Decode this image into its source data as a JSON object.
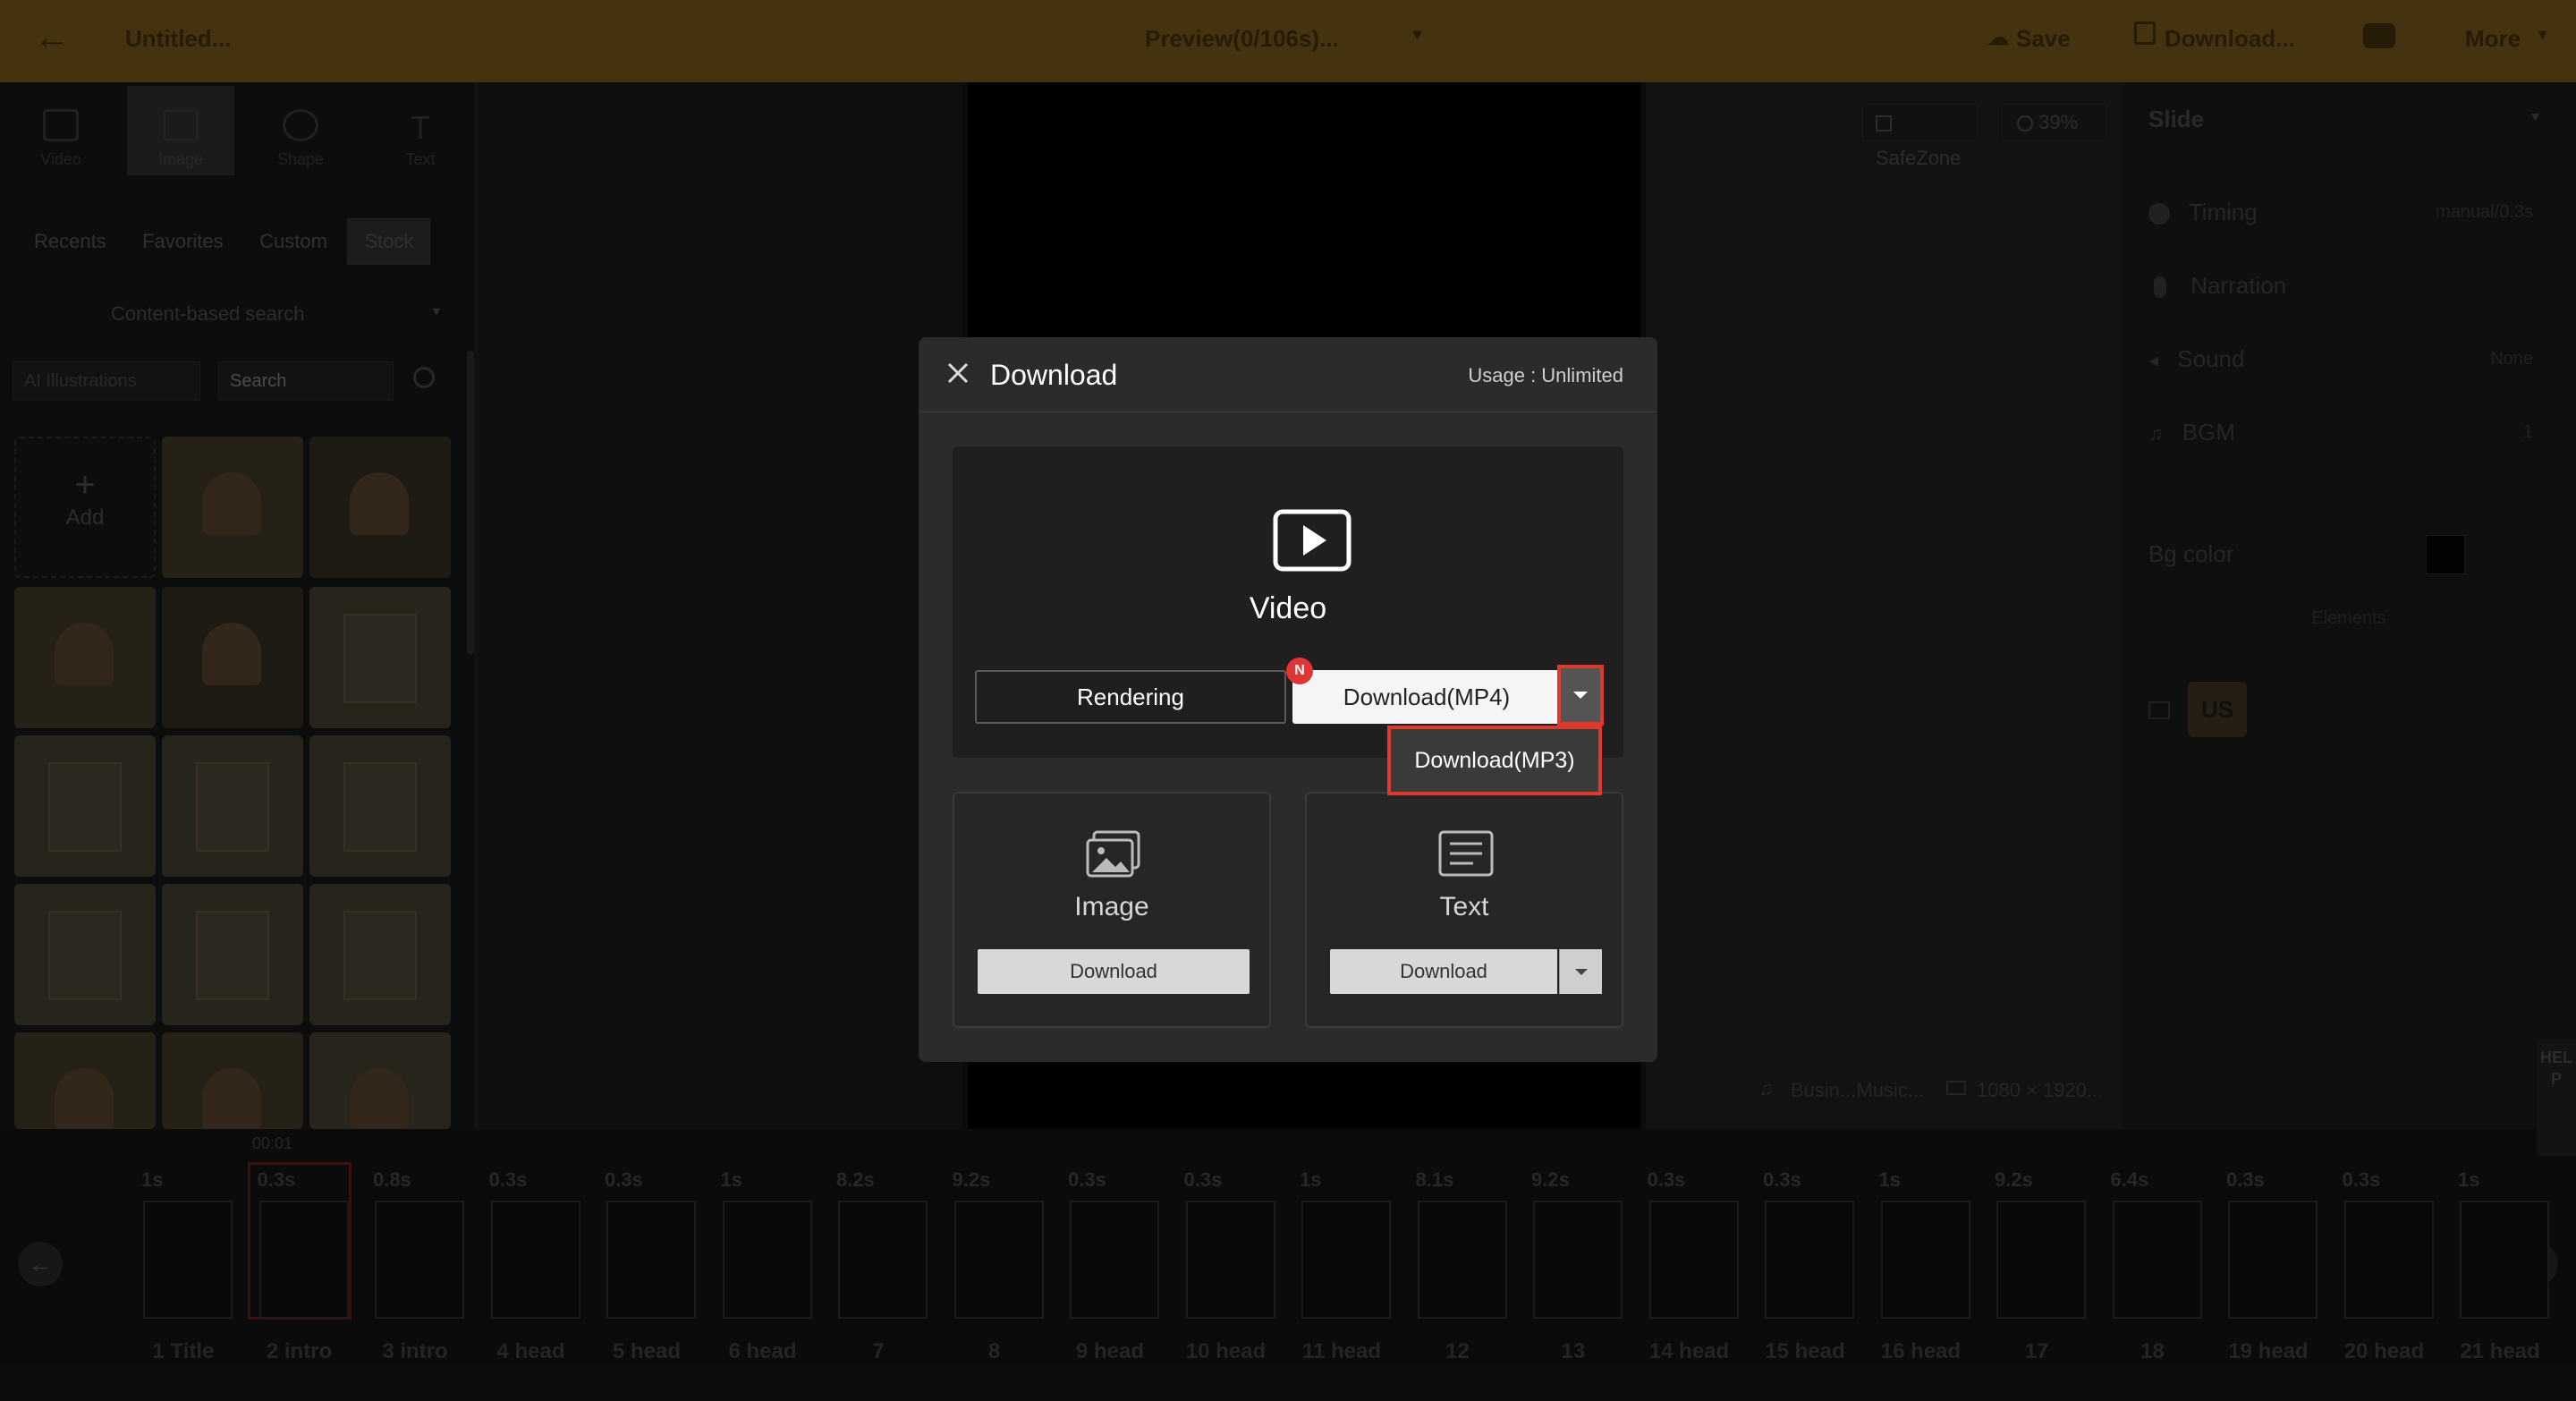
{
  "topbar": {
    "title": "Untitled...",
    "preview": "Preview(0/106s)...",
    "save": "Save",
    "download": "Download...",
    "more": "More"
  },
  "left_tools": [
    "Video",
    "Image",
    "Shape",
    "Text"
  ],
  "left_tabs": [
    "Recents",
    "Favorites",
    "Custom",
    "Stock"
  ],
  "search_mode": "Content-based search",
  "filter_select": "AI Illustrations",
  "search_placeholder": "Search",
  "add_label": "Add",
  "canvas_controls": {
    "safezone": "SafeZone",
    "zoom": "39%"
  },
  "right_panel": {
    "title": "Slide",
    "timing": "Timing",
    "timing_value": "manual/0.3s",
    "narration": "Narration",
    "sound": "Sound",
    "sound_value": "None",
    "bgm": "BGM",
    "bgm_value": "1",
    "bg_color": "Bg color",
    "elements": "Elements"
  },
  "canvas_footer": {
    "music": "Busin...Music...",
    "resolution": "1080 × 1920..."
  },
  "help": "HELP",
  "timeline": {
    "timecode": "00:01",
    "frames": [
      {
        "dur": "1s",
        "label": "1 Title"
      },
      {
        "dur": "0.3s",
        "label": "2 intro"
      },
      {
        "dur": "0.8s",
        "label": "3 intro"
      },
      {
        "dur": "0.3s",
        "label": "4 head"
      },
      {
        "dur": "0.3s",
        "label": "5 head"
      },
      {
        "dur": "1s",
        "label": "6 head"
      },
      {
        "dur": "8.2s",
        "label": "7"
      },
      {
        "dur": "9.2s",
        "label": "8"
      },
      {
        "dur": "0.3s",
        "label": "9 head"
      },
      {
        "dur": "0.3s",
        "label": "10 head"
      },
      {
        "dur": "1s",
        "label": "11 head"
      },
      {
        "dur": "8.1s",
        "label": "12"
      },
      {
        "dur": "9.2s",
        "label": "13"
      },
      {
        "dur": "0.3s",
        "label": "14 head"
      },
      {
        "dur": "0.3s",
        "label": "15 head"
      },
      {
        "dur": "1s",
        "label": "16 head"
      },
      {
        "dur": "9.2s",
        "label": "17"
      },
      {
        "dur": "6.4s",
        "label": "18"
      },
      {
        "dur": "0.3s",
        "label": "19 head"
      },
      {
        "dur": "0.3s",
        "label": "20 head"
      },
      {
        "dur": "1s",
        "label": "21 head"
      }
    ]
  },
  "dialog": {
    "title": "Download",
    "usage": "Usage : Unlimited",
    "video_label": "Video",
    "rendering_button": "Rendering",
    "new_badge": "N",
    "mp4_button": "Download(MP4)",
    "mp3_option": "Download(MP3)",
    "image_label": "Image",
    "image_button": "Download",
    "text_label": "Text",
    "text_button": "Download"
  },
  "colors": {
    "highlight": "#e0392c",
    "badge": "#e03535",
    "topbar": "#6b4f17"
  }
}
